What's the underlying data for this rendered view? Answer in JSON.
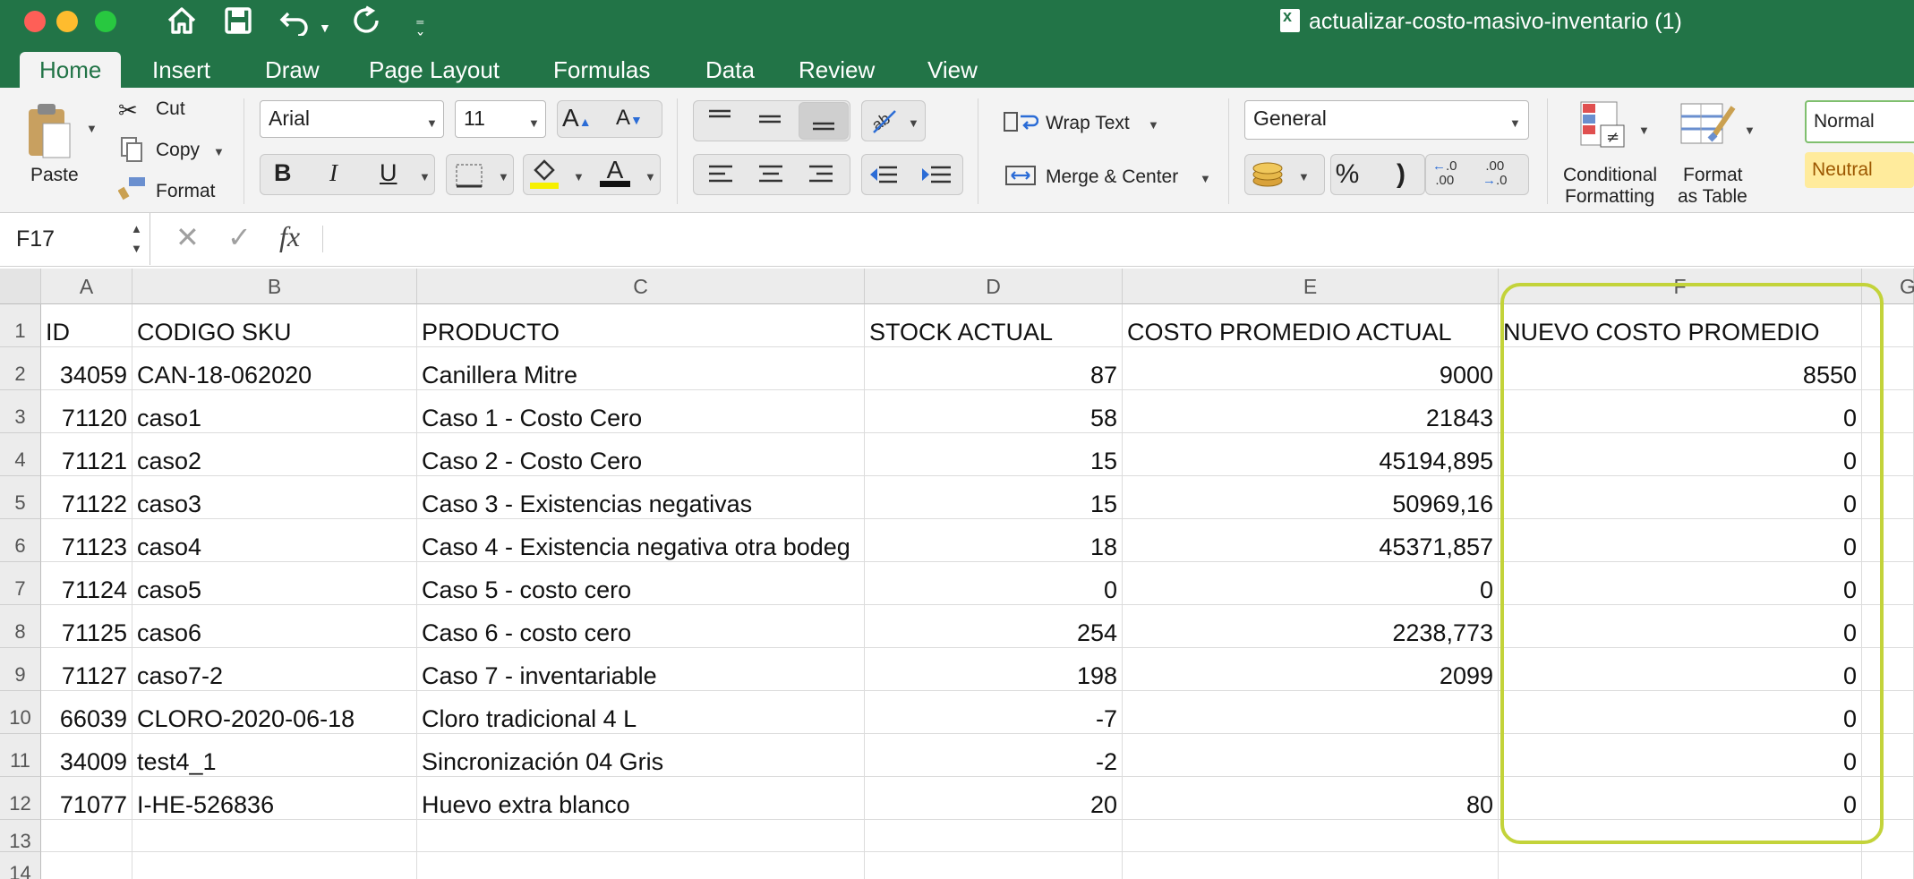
{
  "window": {
    "title": "actualizar-costo-masivo-inventario (1)"
  },
  "tabs": [
    "Home",
    "Insert",
    "Draw",
    "Page Layout",
    "Formulas",
    "Data",
    "Review",
    "View"
  ],
  "active_tab": "Home",
  "clipboard": {
    "paste": "Paste",
    "cut": "Cut",
    "copy": "Copy",
    "format": "Format"
  },
  "font": {
    "name": "Arial",
    "size": "11"
  },
  "alignment": {
    "wrap_text": "Wrap Text",
    "merge_center": "Merge & Center"
  },
  "number": {
    "format": "General",
    "percent": "%",
    "comma": ")"
  },
  "styles": {
    "conditional_1": "Conditional",
    "conditional_2": "Formatting",
    "format_table_1": "Format",
    "format_table_2": "as Table",
    "normal": "Normal",
    "neutral": "Neutral"
  },
  "formula_bar": {
    "cell_ref": "F17",
    "fx": "fx",
    "value": ""
  },
  "columns": [
    "A",
    "B",
    "C",
    "D",
    "E",
    "F",
    "G"
  ],
  "rows": [
    {
      "n": "1",
      "a": "ID",
      "b": "CODIGO SKU",
      "c": "PRODUCTO",
      "d": "STOCK ACTUAL",
      "e": "COSTO PROMEDIO ACTUAL",
      "f": "NUEVO COSTO PROMEDIO"
    },
    {
      "n": "2",
      "a": "34059",
      "b": "CAN-18-062020",
      "c": "Canillera Mitre",
      "d": "87",
      "e": "9000",
      "f": "8550"
    },
    {
      "n": "3",
      "a": "71120",
      "b": "caso1",
      "c": "Caso 1 - Costo Cero",
      "d": "58",
      "e": "21843",
      "f": "0"
    },
    {
      "n": "4",
      "a": "71121",
      "b": "caso2",
      "c": "Caso 2 - Costo Cero",
      "d": "15",
      "e": "45194,895",
      "f": "0"
    },
    {
      "n": "5",
      "a": "71122",
      "b": "caso3",
      "c": "Caso 3 - Existencias negativas",
      "d": "15",
      "e": "50969,16",
      "f": "0"
    },
    {
      "n": "6",
      "a": "71123",
      "b": "caso4",
      "c": "Caso 4 - Existencia negativa otra bodeg",
      "d": "18",
      "e": "45371,857",
      "f": "0"
    },
    {
      "n": "7",
      "a": "71124",
      "b": "caso5",
      "c": "Caso 5 - costo cero",
      "d": "0",
      "e": "0",
      "f": "0"
    },
    {
      "n": "8",
      "a": "71125",
      "b": "caso6",
      "c": "Caso 6 - costo cero",
      "d": "254",
      "e": "2238,773",
      "f": "0"
    },
    {
      "n": "9",
      "a": "71127",
      "b": "caso7-2",
      "c": "Caso 7 - inventariable",
      "d": "198",
      "e": "2099",
      "f": "0"
    },
    {
      "n": "10",
      "a": "66039",
      "b": "CLORO-2020-06-18",
      "c": "Cloro tradicional 4 L",
      "d": "-7",
      "e": "",
      "f": "0"
    },
    {
      "n": "11",
      "a": "34009",
      "b": "test4_1",
      "c": "Sincronización 04 Gris",
      "d": "-2",
      "e": "",
      "f": "0"
    },
    {
      "n": "12",
      "a": "71077",
      "b": "I-HE-526836",
      "c": "Huevo extra blanco",
      "d": "20",
      "e": "80",
      "f": "0"
    },
    {
      "n": "13",
      "a": "",
      "b": "",
      "c": "",
      "d": "",
      "e": "",
      "f": ""
    },
    {
      "n": "14",
      "a": "",
      "b": "",
      "c": "",
      "d": "",
      "e": "",
      "f": ""
    }
  ],
  "colors": {
    "excel_green": "#227447",
    "highlight": "#c3d33a"
  }
}
